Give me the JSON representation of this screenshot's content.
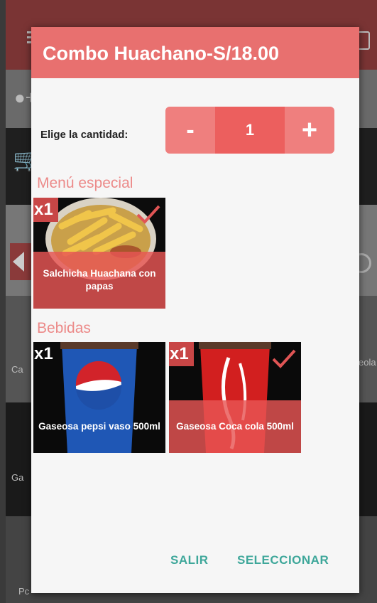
{
  "background_app": {
    "row_left_texts": [
      "Ca",
      "Ga",
      "Pc"
    ],
    "row_right_text": "eola"
  },
  "dialog": {
    "title": "Combo Huachano-S/18.00",
    "quantity": {
      "label": "Elige la cantidad:",
      "minus_label": "-",
      "value": "1",
      "plus_label": "+"
    },
    "sections": [
      {
        "title": "Menú especial",
        "items": [
          {
            "badge": "x1",
            "name": "Salchicha Huachana con papas",
            "selected": true
          }
        ]
      },
      {
        "title": "Bebidas",
        "items": [
          {
            "badge": "x1",
            "name": "Gaseosa pepsi  vaso 500ml",
            "selected": false
          },
          {
            "badge": "x1",
            "name": "Gaseosa Coca cola 500ml",
            "selected": true
          }
        ]
      }
    ],
    "actions": {
      "cancel_label": "SALIR",
      "confirm_label": "SELECCIONAR"
    }
  },
  "colors": {
    "header": "#e8706f",
    "accent": "#ec5f5e",
    "section_title": "#ec8a89",
    "action_text": "#3ea79a"
  }
}
